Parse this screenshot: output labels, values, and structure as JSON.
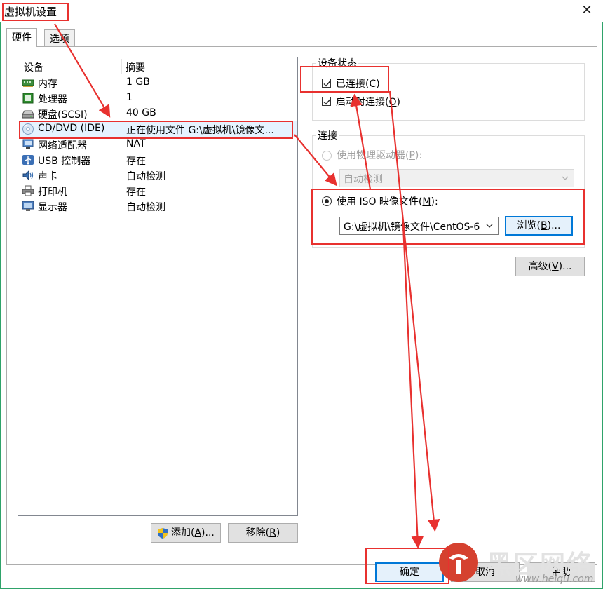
{
  "window": {
    "title": "虚拟机设置",
    "close_glyph": "✕"
  },
  "tabs": [
    {
      "label": "硬件"
    },
    {
      "label": "选项"
    }
  ],
  "device_list": {
    "columns": [
      "设备",
      "摘要"
    ],
    "rows": [
      {
        "name": "内存",
        "summary": "1 GB",
        "icon": "memory-icon"
      },
      {
        "name": "处理器",
        "summary": "1",
        "icon": "processor-icon"
      },
      {
        "name": "硬盘(SCSI)",
        "summary": "40 GB",
        "icon": "hard-disk-icon"
      },
      {
        "name": "CD/DVD (IDE)",
        "summary": "正在使用文件 G:\\虚拟机\\镜像文...",
        "icon": "cd-dvd-icon",
        "selected": true
      },
      {
        "name": "网络适配器",
        "summary": "NAT",
        "icon": "network-adapter-icon"
      },
      {
        "name": "USB 控制器",
        "summary": "存在",
        "icon": "usb-icon"
      },
      {
        "name": "声卡",
        "summary": "自动检测",
        "icon": "sound-card-icon"
      },
      {
        "name": "打印机",
        "summary": "存在",
        "icon": "printer-icon"
      },
      {
        "name": "显示器",
        "summary": "自动检测",
        "icon": "display-icon"
      }
    ],
    "add_button": {
      "text": "添加(",
      "key": "A",
      "suffix": ")..."
    },
    "remove_button": {
      "text": "移除(",
      "key": "R",
      "suffix": ")"
    }
  },
  "device_status": {
    "title": "设备状态",
    "connected": {
      "text": "已连接(",
      "key": "C",
      "suffix": ")",
      "checked": true
    },
    "connect_at_power_on": {
      "text": "启动时连接(",
      "key": "O",
      "suffix": ")",
      "checked": true
    }
  },
  "connection": {
    "title": "连接",
    "physical_drive": {
      "text": "使用物理驱动器(",
      "key": "P",
      "suffix": "):",
      "selected": false,
      "enabled": false
    },
    "physical_select": {
      "value": "自动检测"
    },
    "iso_image": {
      "text": "使用 ISO 映像文件(",
      "key": "M",
      "suffix": "):",
      "selected": true
    },
    "iso_select": {
      "value": "G:\\虚拟机\\镜像文件\\CentOS-6"
    },
    "browse_button": {
      "text": "浏览(",
      "key": "B",
      "suffix": ")..."
    }
  },
  "advanced_button": {
    "text": "高级(",
    "key": "V",
    "suffix": ")..."
  },
  "footer": {
    "ok": "确定",
    "cancel": "取消",
    "help": "帮助"
  },
  "watermark": {
    "text": "黑区网络",
    "url": "www.heiqu.com"
  },
  "colors": {
    "annotation_red": "#e8312f",
    "selection": "#e5f3ff",
    "focus_blue": "#0078d7"
  }
}
